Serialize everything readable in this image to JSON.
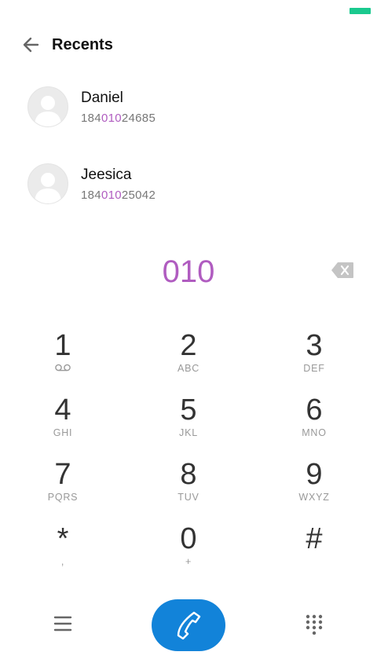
{
  "header": {
    "title": "Recents"
  },
  "contacts": [
    {
      "name": "Daniel",
      "number_prefix": "184",
      "number_match": "010",
      "number_suffix": "24685"
    },
    {
      "name": "Jeesica",
      "number_prefix": "184",
      "number_match": "010",
      "number_suffix": "25042"
    }
  ],
  "dialer": {
    "input": "010"
  },
  "keys": [
    {
      "digit": "1",
      "letters": ""
    },
    {
      "digit": "2",
      "letters": "ABC"
    },
    {
      "digit": "3",
      "letters": "DEF"
    },
    {
      "digit": "4",
      "letters": "GHI"
    },
    {
      "digit": "5",
      "letters": "JKL"
    },
    {
      "digit": "6",
      "letters": "MNO"
    },
    {
      "digit": "7",
      "letters": "PQRS"
    },
    {
      "digit": "8",
      "letters": "TUV"
    },
    {
      "digit": "9",
      "letters": "WXYZ"
    },
    {
      "digit": "*",
      "letters": ","
    },
    {
      "digit": "0",
      "letters": "+"
    },
    {
      "digit": "#",
      "letters": ""
    }
  ],
  "colors": {
    "accent": "#b05cc0",
    "call": "#1283d9",
    "battery": "#1ac98e"
  },
  "icons": {
    "back": "arrow-left-icon",
    "backspace": "backspace-icon",
    "voicemail": "voicemail-icon",
    "menu": "menu-icon",
    "call": "phone-icon",
    "dialpad": "dialpad-icon"
  }
}
